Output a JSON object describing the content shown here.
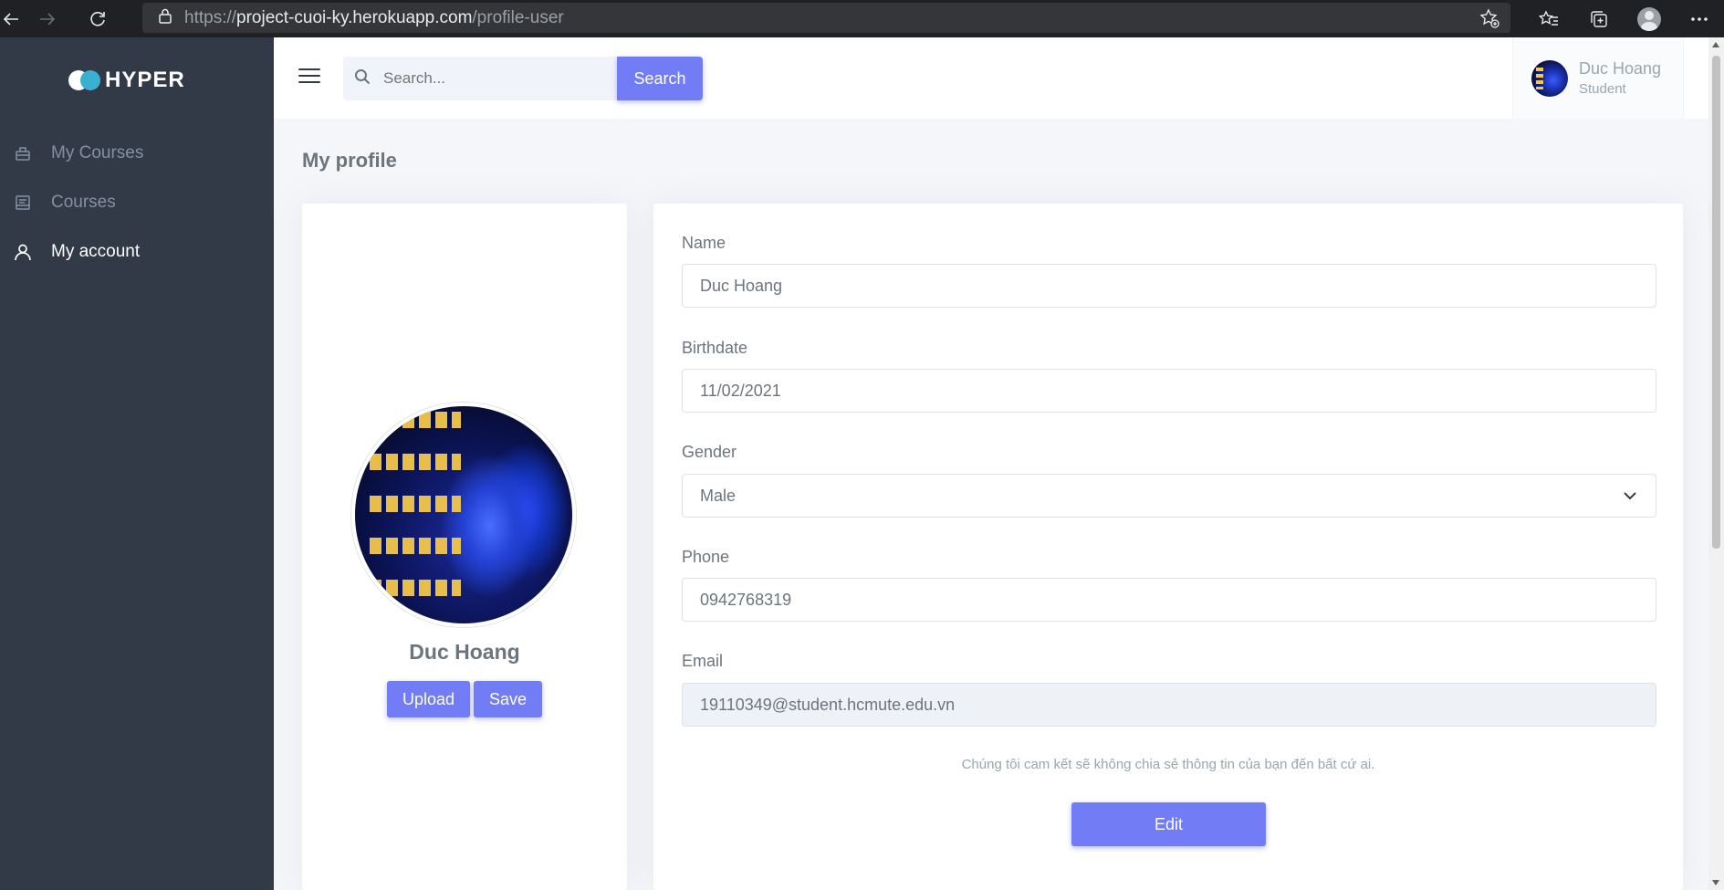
{
  "browser": {
    "url_prefix": "https://",
    "url_host": "project-cuoi-ky.herokuapp.com",
    "url_path": "/profile-user"
  },
  "brand": {
    "name": "HYPER"
  },
  "sidebar": {
    "items": [
      {
        "label": "My Courses",
        "icon": "briefcase-icon"
      },
      {
        "label": "Courses",
        "icon": "book-icon"
      },
      {
        "label": "My account",
        "icon": "user-icon",
        "active": true
      }
    ]
  },
  "topbar": {
    "search_placeholder": "Search...",
    "search_button": "Search",
    "user_name": "Duc Hoang",
    "user_role": "Student"
  },
  "page": {
    "title": "My profile"
  },
  "profile": {
    "name": "Duc Hoang",
    "upload_label": "Upload",
    "save_label": "Save"
  },
  "form": {
    "name_label": "Name",
    "name_value": "Duc Hoang",
    "birthdate_label": "Birthdate",
    "birthdate_value": "11/02/2021",
    "gender_label": "Gender",
    "gender_value": "Male",
    "phone_label": "Phone",
    "phone_value": "0942768319",
    "email_label": "Email",
    "email_value": "19110349@student.hcmute.edu.vn",
    "note": "Chúng tôi cam kết sẽ không chia sẻ thông tin của bạn đến bất cứ ai.",
    "edit_label": "Edit"
  },
  "colors": {
    "primary": "#727cf5",
    "sidebar_bg": "#313a46",
    "text_muted": "#6c757d"
  }
}
